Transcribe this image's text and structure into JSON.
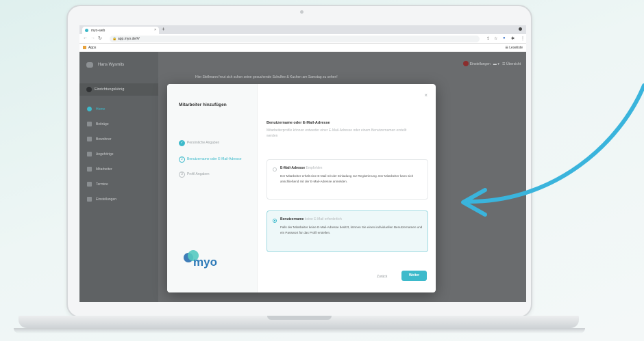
{
  "browser": {
    "tab_title": "myo-web",
    "tab_close": "×",
    "new_tab": "+",
    "url": "app.myo.de/#/",
    "bookmarks_apps": "Apps",
    "reading_list": "Leseliste"
  },
  "sidebar": {
    "user_name": "Hans Wysmits",
    "org_name": "Einrichtungskönig",
    "items": [
      {
        "label": "Home"
      },
      {
        "label": "Beiträge"
      },
      {
        "label": "Bewohner"
      },
      {
        "label": "Angehörige"
      },
      {
        "label": "Mitarbeiter"
      },
      {
        "label": "Termine"
      },
      {
        "label": "Einstellungen"
      }
    ]
  },
  "topbar": {
    "settings": "Einstellungen",
    "menu": "Übersicht"
  },
  "announcement": "Hier Stellmann freut sich schon seine gesuchende Schulfee & Kuchen am Samstag zu sehen!",
  "modal": {
    "title": "Mitarbeiter hinzufügen",
    "close": "×",
    "steps": [
      {
        "label": "Persönliche Angaben",
        "state": "done",
        "num": "✓"
      },
      {
        "label": "Benutzername oder E-Mail-Adresse",
        "state": "current",
        "num": "2"
      },
      {
        "label": "Profil Angaben",
        "state": "todo",
        "num": "3"
      }
    ],
    "heading": "Benutzername oder E-Mail-Adresse",
    "subheading": "Mitarbeiterprofile können entweder einer E-Mail-Adresse oder einem Benutzernamen erstellt werden",
    "options": [
      {
        "title": "E-Mail-Adresse",
        "tag": "Empfohlen",
        "desc": "Der Mitarbeiter erhält eine E-Mail mit der Einladung zur Registrierung. Der Mitarbeiter kann sich anschließend mit der E-Mail-Adresse anmelden."
      },
      {
        "title": "Benutzername",
        "tag": "keine E-Mail erforderlich",
        "desc": "Falls der Mitarbeiter keine E-Mail-Adresse besitzt, können Sie einen individuellen Benutzernamen und ein Passwort für das Profil erstellen."
      }
    ],
    "back_label": "Zurück",
    "next_label": "Weiter",
    "logo_text": "myo"
  },
  "colors": {
    "accent": "#3dbacb",
    "arrow": "#3ab4dc"
  }
}
